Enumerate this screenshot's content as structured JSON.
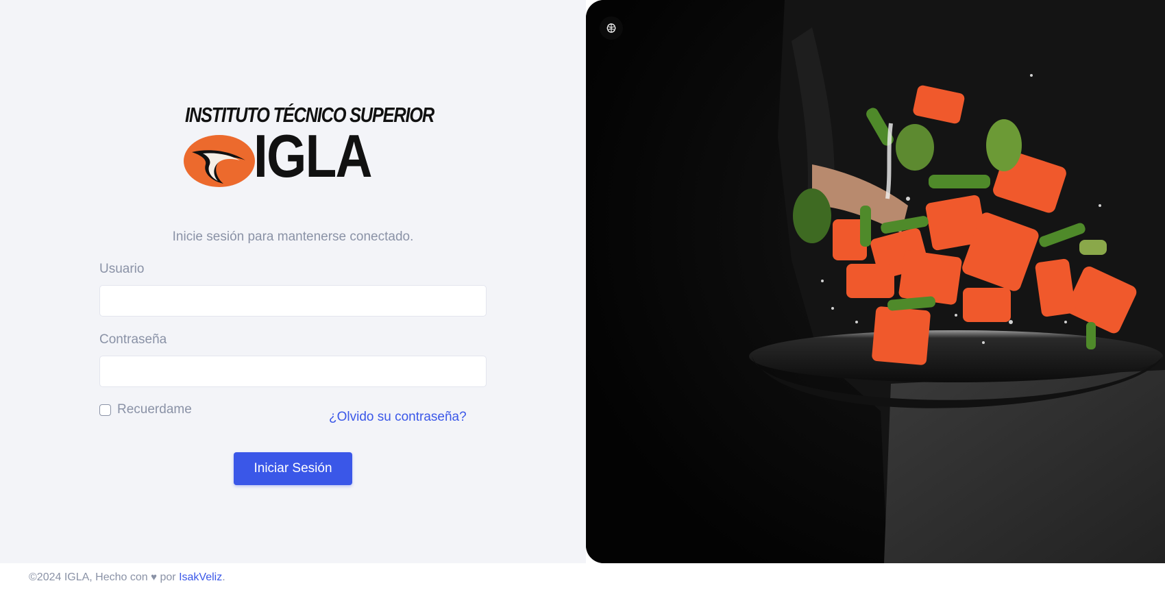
{
  "logo": {
    "top_text": "INSTITUTO TÉCNICO SUPERIOR",
    "word": "IGLA",
    "brand_orange": "#ec6a2d"
  },
  "login": {
    "subtitle": "Inicie sesión para mantenerse conectado.",
    "username_label": "Usuario",
    "username_value": "",
    "password_label": "Contraseña",
    "password_value": "",
    "remember_label": "Recuerdame",
    "remember_checked": false,
    "forgot_link": "¿Olvido su contraseña?",
    "submit_label": "Iniciar Sesión"
  },
  "hero": {
    "corner_icon": "brain-icon",
    "image": "chef-tossing-salmon-and-vegetables-in-pan"
  },
  "footer": {
    "copyright": "©2024 IGLA, Hecho con",
    "heart_icon": "heart-icon",
    "by": "por",
    "author_link": "IsakVeliz",
    "end": "."
  },
  "colors": {
    "accent": "#3a57e8",
    "muted_text": "#8a92a6",
    "left_bg": "#f3f4f8"
  }
}
